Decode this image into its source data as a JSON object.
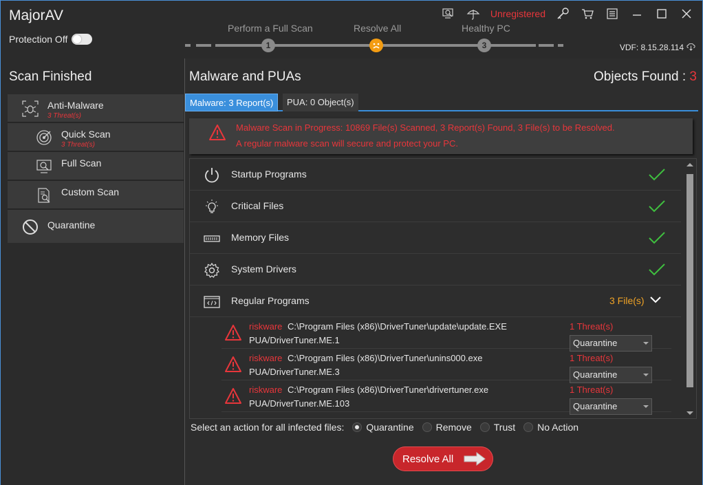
{
  "app": {
    "title": "MajorAV",
    "protection_label": "Protection Off",
    "unregistered": "Unregistered",
    "vdf": "VDF: 8.15.28.114"
  },
  "steps": [
    {
      "label": "Perform a Full Scan",
      "num": "1"
    },
    {
      "label": "Resolve All",
      "num": "!"
    },
    {
      "label": "Healthy PC",
      "num": "3"
    }
  ],
  "sidebar": {
    "title": "Scan Finished",
    "items": [
      {
        "label": "Anti-Malware",
        "threats": "3 Threat(s)"
      },
      {
        "label": "Quick Scan",
        "threats": "3 Threat(s)"
      },
      {
        "label": "Full Scan"
      },
      {
        "label": "Custom Scan"
      },
      {
        "label": "Quarantine"
      }
    ]
  },
  "main": {
    "title": "Malware and PUAs",
    "objects_label": "Objects Found : ",
    "objects_count": "3",
    "tabs": [
      {
        "label": "Malware: 3 Report(s)"
      },
      {
        "label": "PUA: 0 Object(s)"
      }
    ],
    "alert": {
      "line1": "Malware Scan in Progress: 10869 File(s) Scanned, 3 Report(s) Found, 3 File(s) to be Resolved.",
      "line2": "A regular malware scan will secure and protect your PC."
    },
    "categories": [
      {
        "label": "Startup Programs"
      },
      {
        "label": "Critical Files"
      },
      {
        "label": "Memory Files"
      },
      {
        "label": "System Drivers"
      },
      {
        "label": "Regular Programs",
        "files": "3 File(s)"
      }
    ],
    "threats": [
      {
        "type": "riskware",
        "path": "C:\\Program Files (x86)\\DriverTuner\\update\\update.EXE",
        "name": "PUA/DriverTuner.ME.1",
        "count": "1 Threat(s)",
        "action": "Quarantine"
      },
      {
        "type": "riskware",
        "path": "C:\\Program Files (x86)\\DriverTuner\\unins000.exe",
        "name": "PUA/DriverTuner.ME.3",
        "count": "1 Threat(s)",
        "action": "Quarantine"
      },
      {
        "type": "riskware",
        "path": "C:\\Program Files (x86)\\DriverTuner\\drivertuner.exe",
        "name": "PUA/DriverTuner.ME.103",
        "count": "1 Threat(s)",
        "action": "Quarantine"
      }
    ],
    "actions": {
      "label": "Select an action for all infected files:",
      "options": [
        "Quarantine",
        "Remove",
        "Trust",
        "No Action"
      ],
      "selected": "Quarantine"
    },
    "resolve_button": "Resolve All"
  },
  "colors": {
    "accent_blue": "#3a8fdc",
    "danger_red": "#e8363b",
    "warning_orange": "#f0a326",
    "success_green": "#3fbf3f"
  }
}
